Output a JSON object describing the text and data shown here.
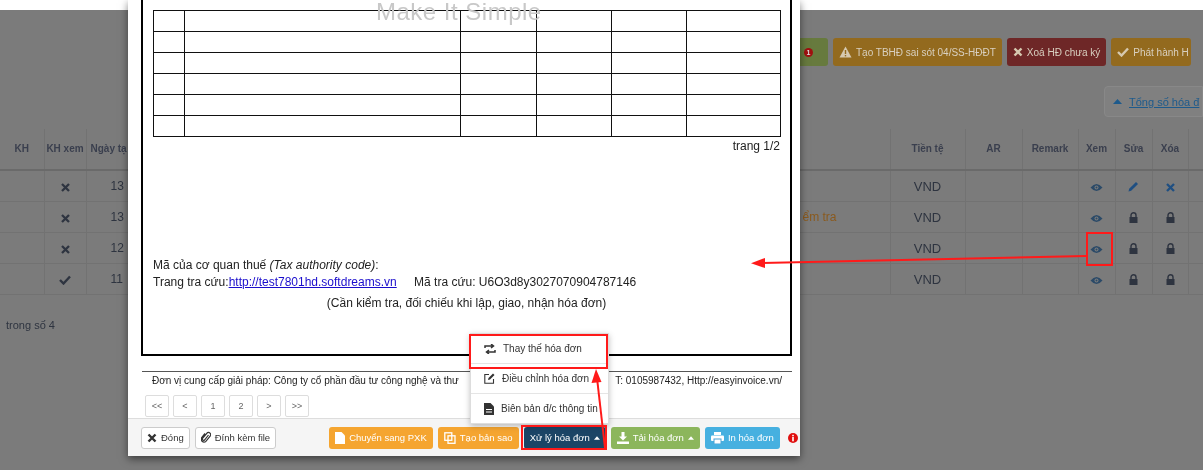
{
  "background": {
    "toolbar": {
      "alert_badge": "1",
      "buttons": [
        {
          "kind": "warning",
          "label": "Tạo TBHĐ sai sót 04/SS-HĐĐT"
        },
        {
          "kind": "danger",
          "label": "Xoá HĐ chưa ký"
        },
        {
          "kind": "publish",
          "label": "Phát hành H"
        }
      ]
    },
    "summary_link": "Tổng số hóa đ",
    "table": {
      "left_columns": [
        "KH",
        "KH xem",
        "Ngày tạ"
      ],
      "right_columns": [
        "Tiền tệ",
        "AR",
        "Remark",
        "Xem",
        "Sửa",
        "Xóa"
      ],
      "rows": [
        {
          "customer_viewed": false,
          "date": "13",
          "currency": "VND",
          "editable": true
        },
        {
          "customer_viewed": false,
          "date": "13",
          "status": "ểm tra",
          "currency": "VND",
          "editable": false
        },
        {
          "customer_viewed": false,
          "date": "12",
          "currency": "VND",
          "editable": false
        },
        {
          "customer_viewed": true,
          "date": "11",
          "currency": "VND",
          "editable": false
        }
      ]
    },
    "footer_text": "trong số 4"
  },
  "invoice_dialog": {
    "document": {
      "logo_text": "Make It Simple",
      "page_label": "trang 1/2",
      "tax_code_label": "Mã của cơ quan thuế *(Tax authority code)*:",
      "lookup_label": "Trang tra cứu:",
      "lookup_link": "http://test7801hd.softdreams.vn",
      "lookup_code": "Mã tra cứu: U6O3d8y3027070904787146",
      "notice": "(Cần kiểm tra, đối chiếu khi lập, giao, nhận hóa đơn)"
    },
    "provider_note": [
      "Đơn vị cung cấp giải pháp: Công ty cổ phần đầu tư công nghệ và thư",
      "T: 0105987432, Http://easyinvoice.vn/"
    ],
    "pagination": [
      "<<",
      "<",
      "1",
      "2",
      ">",
      ">>"
    ],
    "buttons": [
      {
        "kind": "close",
        "label": "Đóng"
      },
      {
        "kind": "attach",
        "label": "Đính kèm file"
      },
      {
        "kind": "convert",
        "label": "Chuyển sang PXK"
      },
      {
        "kind": "copy",
        "label": "Tạo bản sao"
      },
      {
        "kind": "process",
        "label": "Xử lý hóa đơn",
        "dropdown": true,
        "expanded": true
      },
      {
        "kind": "download",
        "label": "Tải hóa đơn",
        "dropdown": true
      },
      {
        "kind": "print",
        "label": "In hóa đơn"
      }
    ],
    "menu": [
      {
        "kind": "replace",
        "label": "Thay thế hóa đơn"
      },
      {
        "kind": "adjust",
        "label": "Điều chỉnh hóa đơn"
      },
      {
        "kind": "document",
        "label": "Biên bản đ/c thông tin"
      }
    ]
  }
}
